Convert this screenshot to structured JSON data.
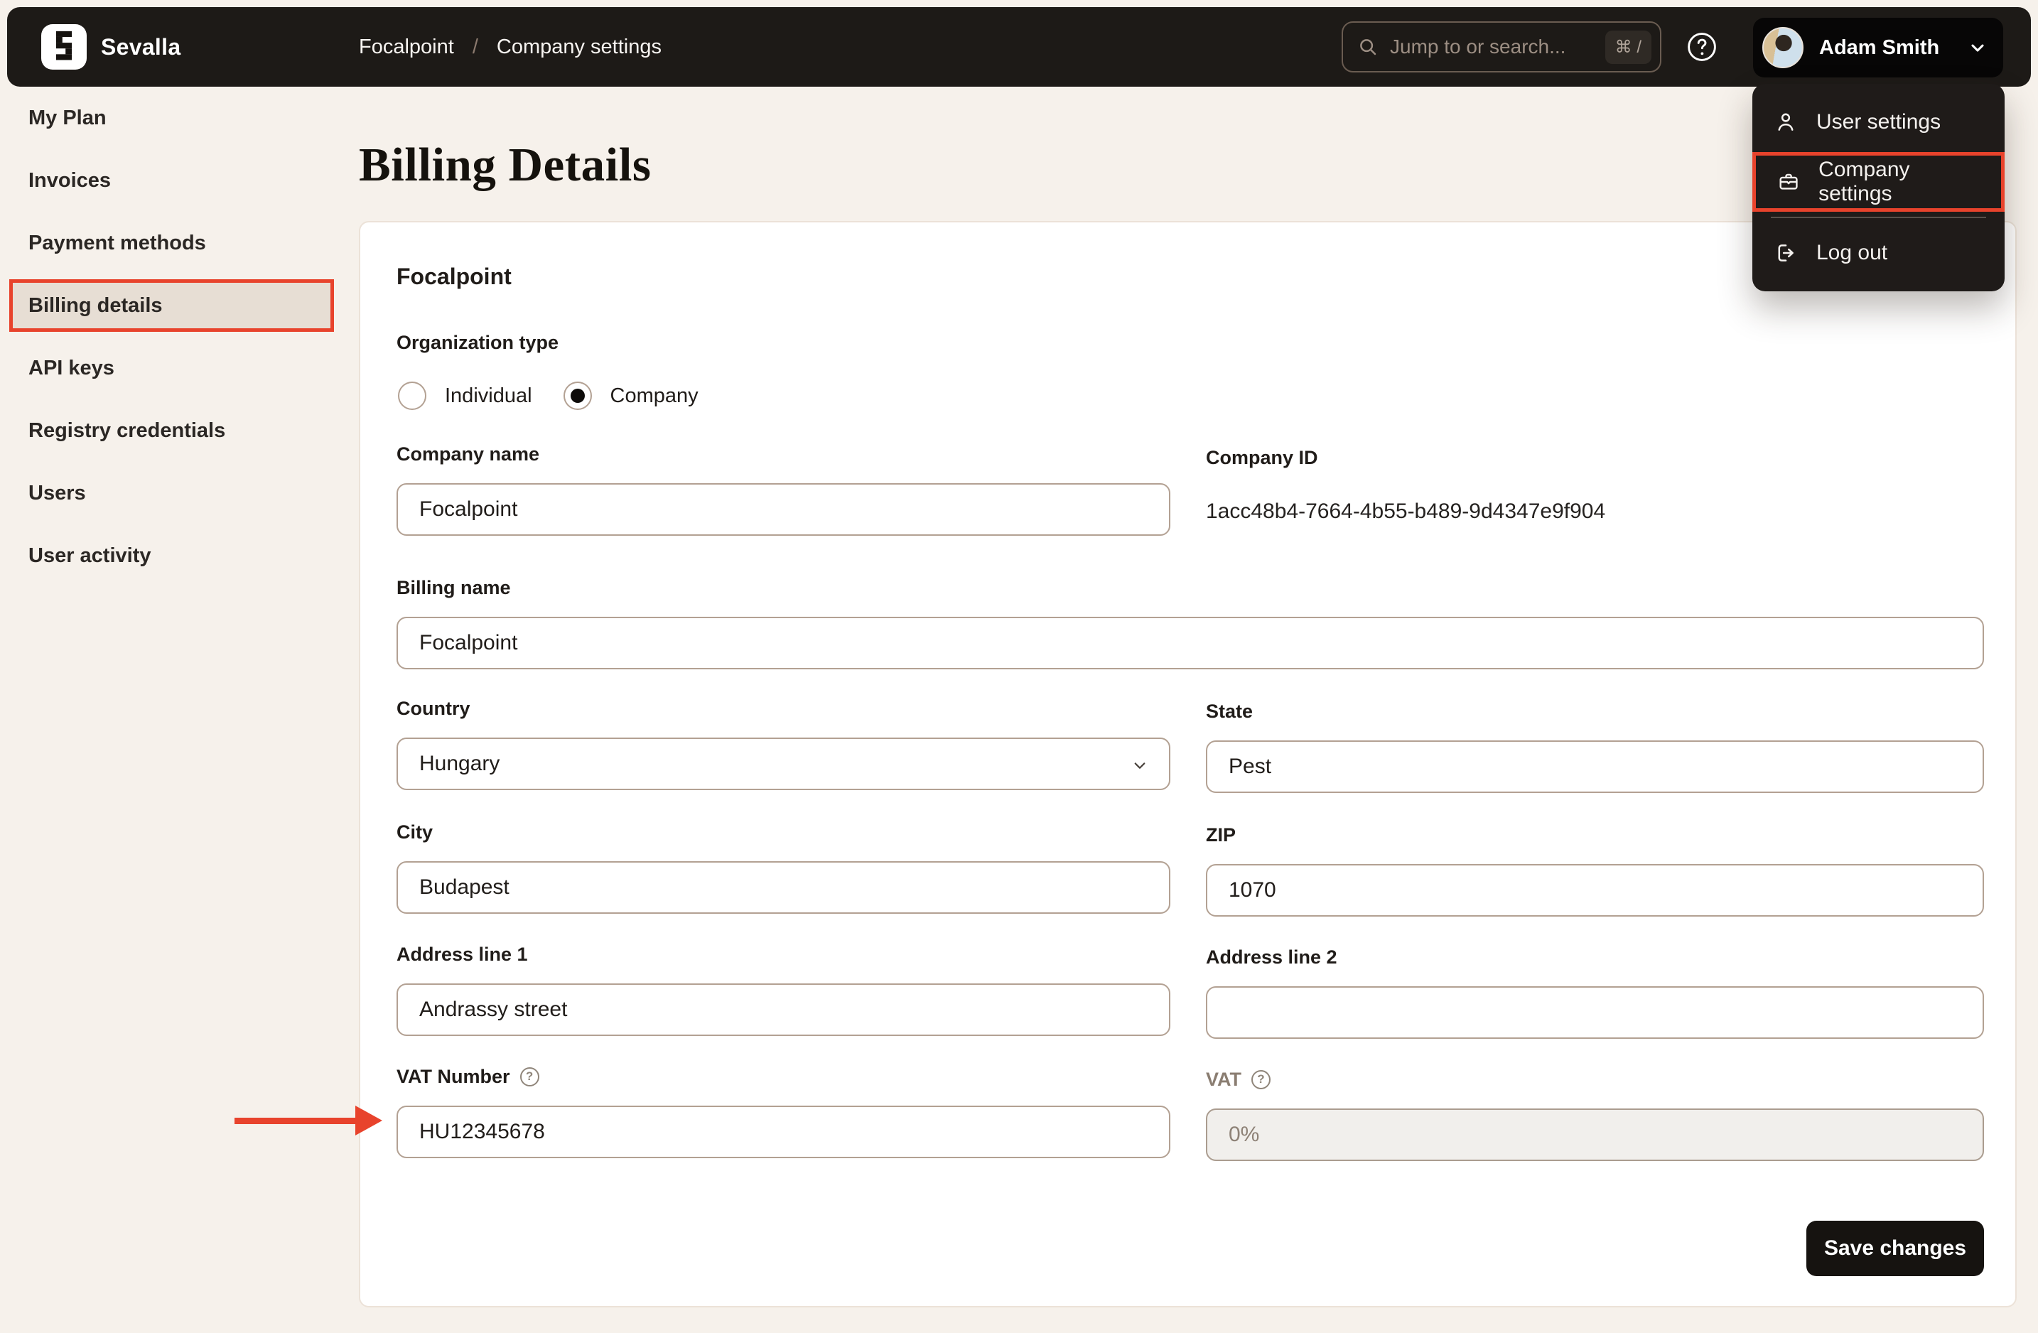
{
  "topbar": {
    "brand": "Sevalla",
    "breadcrumb": {
      "items": [
        "Focalpoint",
        "Company settings"
      ],
      "separator": "/"
    },
    "search": {
      "placeholder": "Jump to or search...",
      "shortcut": "⌘ /"
    },
    "user": {
      "name": "Adam Smith"
    }
  },
  "user_menu": {
    "items": [
      {
        "label": "User settings"
      },
      {
        "label": "Company settings",
        "highlighted": true
      },
      {
        "label": "Log out"
      }
    ]
  },
  "sidebar": {
    "items": [
      {
        "label": "My Plan"
      },
      {
        "label": "Invoices"
      },
      {
        "label": "Payment methods"
      },
      {
        "label": "Billing details",
        "active": true
      },
      {
        "label": "API keys"
      },
      {
        "label": "Registry credentials"
      },
      {
        "label": "Users"
      },
      {
        "label": "User activity"
      }
    ]
  },
  "page": {
    "title": "Billing Details",
    "card": {
      "heading": "Focalpoint",
      "organization_type": {
        "label": "Organization type",
        "options": [
          {
            "label": "Individual",
            "selected": false
          },
          {
            "label": "Company",
            "selected": true
          }
        ]
      },
      "fields": {
        "company_name": {
          "label": "Company name",
          "value": "Focalpoint"
        },
        "company_id": {
          "label": "Company ID",
          "value": "1acc48b4-7664-4b55-b489-9d4347e9f904"
        },
        "billing_name": {
          "label": "Billing name",
          "value": "Focalpoint"
        },
        "country": {
          "label": "Country",
          "value": "Hungary"
        },
        "state": {
          "label": "State",
          "value": "Pest"
        },
        "city": {
          "label": "City",
          "value": "Budapest"
        },
        "zip": {
          "label": "ZIP",
          "value": "1070"
        },
        "address_line_1": {
          "label": "Address line 1",
          "value": "Andrassy street"
        },
        "address_line_2": {
          "label": "Address line 2",
          "value": ""
        },
        "vat_number": {
          "label": "VAT Number",
          "value": "HU12345678"
        },
        "vat": {
          "label": "VAT",
          "value": "0%",
          "disabled": true
        }
      },
      "save_label": "Save changes"
    }
  },
  "icons": {
    "question_glyph": "?"
  },
  "colors": {
    "accent_red": "#e8432c",
    "topbar_bg": "#1d1a17",
    "page_bg": "#f6f1eb",
    "active_item_bg": "#e7ded4",
    "input_border": "#b3a193",
    "menu_bg": "#1f1b19"
  }
}
